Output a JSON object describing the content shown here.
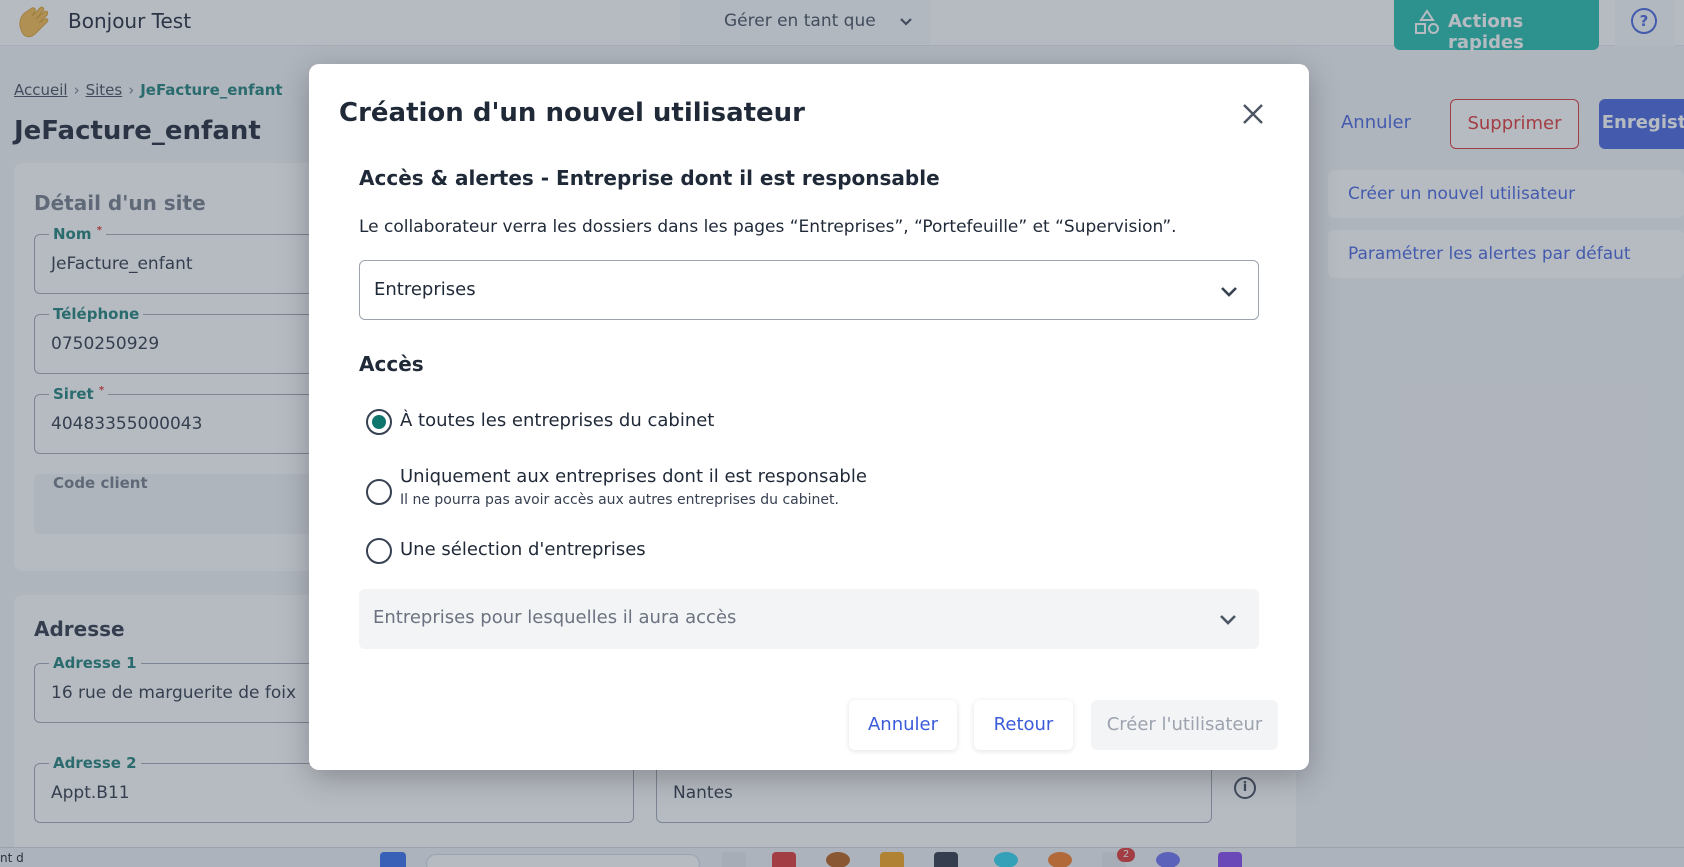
{
  "topbar": {
    "greeting": "Bonjour Test",
    "manage_as": "Gérer en tant que",
    "quick_actions": "Actions rapides"
  },
  "breadcrumb": {
    "home": "Accueil",
    "sites": "Sites",
    "current": "JeFacture_enfant"
  },
  "page": {
    "title": "JeFacture_enfant",
    "actions": {
      "cancel": "Annuler",
      "delete": "Supprimer",
      "save": "Enregistrer"
    },
    "side_links": [
      "Créer un nouvel utilisateur",
      "Paramétrer les alertes par défaut"
    ]
  },
  "site_detail": {
    "title": "Détail d'un site",
    "fields": {
      "name": {
        "label": "Nom",
        "value": "JeFacture_enfant"
      },
      "phone": {
        "label": "Téléphone",
        "value": "0750250929"
      },
      "siret": {
        "label": "Siret",
        "value": "40483355000043"
      },
      "client_code": {
        "label": "Code client",
        "value": ""
      }
    },
    "required_mark": "*"
  },
  "address": {
    "title": "Adresse",
    "address1": {
      "label": "Adresse 1",
      "value": "16 rue de marguerite de foix"
    },
    "address2": {
      "label": "Adresse 2",
      "value": "Appt.B11"
    },
    "city": {
      "value": "Nantes"
    }
  },
  "modal": {
    "title": "Création d'un nouvel utilisateur",
    "section_title": "Accès & alertes - Entreprise dont il est responsable",
    "description": "Le collaborateur verra les dossiers dans les pages “Entreprises”, “Portefeuille” et “Supervision”.",
    "scope_select": "Entreprises",
    "access_title": "Accès",
    "options": [
      {
        "label": "À toutes les entreprises du cabinet",
        "sub": "",
        "checked": true
      },
      {
        "label": "Uniquement aux entreprises dont il est responsable",
        "sub": "Il ne pourra pas avoir accès aux autres entreprises du cabinet.",
        "checked": false
      },
      {
        "label": "Une sélection d'entreprises",
        "sub": "",
        "checked": false
      }
    ],
    "companies_placeholder": "Entreprises pour lesquelles il aura accès",
    "buttons": {
      "cancel": "Annuler",
      "back": "Retour",
      "create": "Créer l'utilisateur"
    }
  },
  "taskbar": {
    "left_text": "nt d",
    "badge": "2"
  },
  "colors": {
    "accent": "#3b5bdb",
    "teal": "#0f766e",
    "quick_actions_bg": "#14b8a6",
    "danger": "#dc2626"
  },
  "icons": [
    "waving-hand-icon",
    "chevron-down-icon",
    "shapes-icon",
    "help-icon",
    "close-icon",
    "info-icon"
  ]
}
